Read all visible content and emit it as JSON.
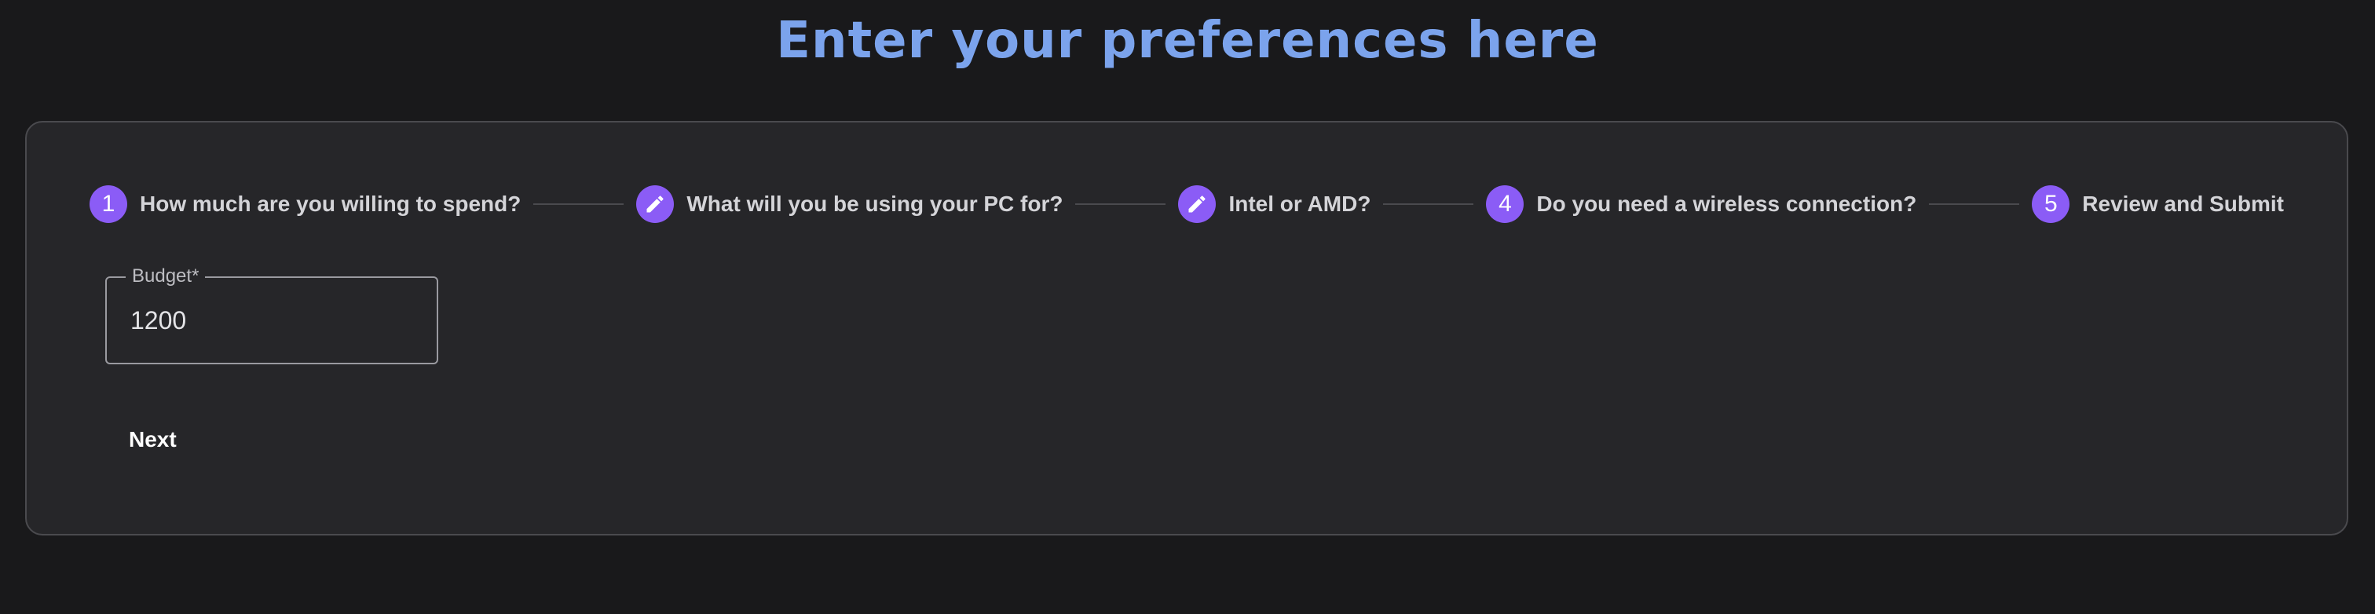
{
  "page": {
    "title": "Enter your preferences here"
  },
  "stepper": {
    "steps": [
      {
        "marker": "1",
        "icon": null,
        "label": "How much are you willing to spend?"
      },
      {
        "marker": null,
        "icon": "pencil-icon",
        "label": "What will you be using your PC for?"
      },
      {
        "marker": null,
        "icon": "pencil-icon",
        "label": "Intel or AMD?"
      },
      {
        "marker": "4",
        "icon": null,
        "label": "Do you need a wireless connection?"
      },
      {
        "marker": "5",
        "icon": null,
        "label": "Review and Submit"
      }
    ]
  },
  "form": {
    "budget_label": "Budget*",
    "budget_value": "1200",
    "next_label": "Next"
  },
  "colors": {
    "background": "#19191b",
    "card": "#262629",
    "title": "#7ba3ec",
    "step_accent": "#8b5cf6"
  }
}
